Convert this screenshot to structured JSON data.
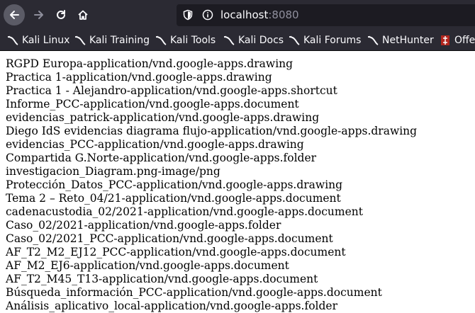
{
  "toolbar": {
    "url_host": "localhost",
    "url_port": ":8080"
  },
  "bookmarks": [
    {
      "label": "Kali Linux",
      "icon": "kali-dragon-icon"
    },
    {
      "label": "Kali Training",
      "icon": "kali-dragon-icon"
    },
    {
      "label": "Kali Tools",
      "icon": "kali-dragon-icon"
    },
    {
      "label": "Kali Docs",
      "icon": "kali-dragon-icon"
    },
    {
      "label": "Kali Forums",
      "icon": "kali-dragon-icon"
    },
    {
      "label": "NetHunter",
      "icon": "kali-dragon-icon"
    },
    {
      "label": "Offe",
      "icon": "offsec-icon"
    }
  ],
  "files": [
    "RGPD Europa-application/vnd.google-apps.drawing",
    "Practica 1-application/vnd.google-apps.drawing",
    "Practica 1 - Alejandro-application/vnd.google-apps.shortcut",
    "Informe_PCC-application/vnd.google-apps.document",
    "evidencias_patrick-application/vnd.google-apps.drawing",
    "Diego IdS evidencias diagrama flujo-application/vnd.google-apps.drawing",
    "evidencias_PCC-application/vnd.google-apps.drawing",
    "Compartida G.Norte-application/vnd.google-apps.folder",
    "investigacion_Diagram.png-image/png",
    "Protección_Datos_PCC-application/vnd.google-apps.drawing",
    "Tema 2 – Reto_04/21-application/vnd.google-apps.document",
    "cadenacustodia_02/2021-application/vnd.google-apps.document",
    "Caso_02/2021-application/vnd.google-apps.folder",
    "Caso_02/2021_PCC-application/vnd.google-apps.document",
    "AF_T2_M2_EJ12_PCC-application/vnd.google-apps.document",
    "AF_M2_EJ6-application/vnd.google-apps.document",
    "AF_T2_M45_T13-application/vnd.google-apps.document",
    "Búsqueda_información_PCC-application/vnd.google-apps.document",
    "Análisis_aplicativo_local-application/vnd.google-apps.folder"
  ]
}
